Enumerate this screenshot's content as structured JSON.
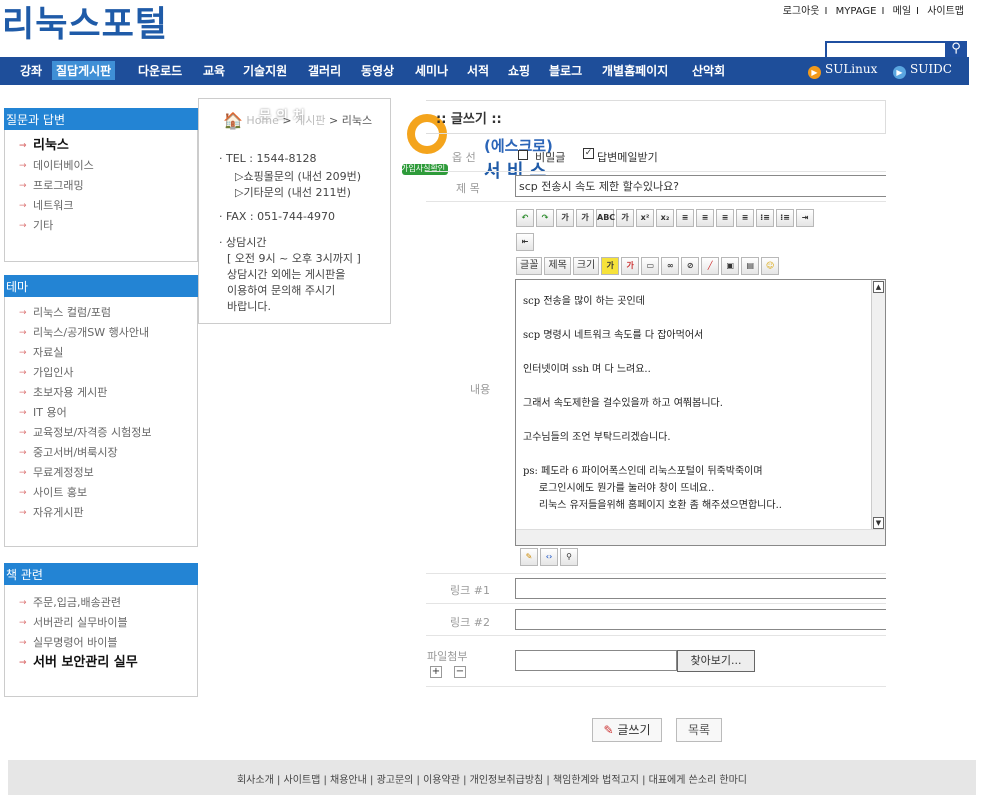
{
  "brand": {
    "logo": "리눅스포털"
  },
  "top_links": [
    "로그아웃",
    "MYPAGE",
    "메일",
    "사이트맵"
  ],
  "nav": {
    "items": [
      "강좌",
      "질답게시판",
      "다운로드",
      "교육",
      "기술지원",
      "갤러리",
      "동영상",
      "세미나",
      "서적",
      "쇼핑",
      "블로그",
      "개별홈페이지",
      "산악회"
    ],
    "active": "질답게시판",
    "ext": [
      "SULinux",
      "SUIDC"
    ]
  },
  "sidebar": {
    "qa": {
      "title": "질문과 답변",
      "items": [
        "리눅스",
        "데이터베이스",
        "프로그래밍",
        "네트워크",
        "기타"
      ]
    },
    "theme": {
      "title": "테마",
      "items": [
        "리눅스 컬럼/포럼",
        "리눅스/공개SW 행사안내",
        "자료실",
        "가입인사",
        "초보자용 게시판",
        "IT 용어",
        "교육정보/자격증 시험정보",
        "중고서버/벼룩시장",
        "무료계정정보",
        "사이트 홍보",
        "자유게시판"
      ]
    },
    "books": {
      "title": "책 관련",
      "items": [
        "주문,입금,배송관련",
        "서버관리 실무바이블",
        "실무명령어 바이블",
        "서버 보안관리 실무"
      ]
    }
  },
  "popup": {
    "title": "문의처",
    "lines": [
      "· TEL : 1544-8128",
      "▷쇼핑몰문의 (내선 209번)",
      "▷기타문의 (내선 211번)",
      "· FAX : 051-744-4970",
      "· 상담시간",
      "[ 오전 9시 ~ 오후 3시까지 ]",
      "상담시간 외에는 게시판을",
      "이용하여 문의해 주시기",
      "바랍니다."
    ]
  },
  "breadcrumb": [
    "Home",
    ">",
    "게시판",
    ">",
    "리눅스"
  ],
  "badge": {
    "line1": "(에스크로)",
    "line2": "서 비 스",
    "tag": "가입사실확인"
  },
  "form": {
    "heading": ":: 글쓰기 ::",
    "options_label": "옵 선",
    "secret_label": "비밀글",
    "email_label": "답변메일받기",
    "subject_label": "제 목",
    "subject_value": "scp 전송시 속도 제한 할수있나요?",
    "content_label": "내용",
    "toolbar_row3": [
      "글꼴",
      "제목",
      "크기"
    ],
    "body_lines": [
      "scp 전송을 많이 하는 곳인데",
      "scp 명령시 네트워크 속도를 다 잡아먹어서",
      "인터넷이며 ssh 며 다 느려요..",
      "그래서 속도제한을 걸수있을까 하고 여쭤봅니다.",
      "고수님들의 조언 부탁드리겠습니다.",
      "ps: 페도라 6 파이어폭스인데 리눅스포털이 뒤죽박죽이며",
      "     로그인시에도 뭔가를 눌러야 창이 뜨네요..",
      "     리눅스 유저들을위해 홈페이지 호환 좀 해주셨으면합니다.."
    ],
    "link1_label": "링크 #1",
    "link2_label": "링크 #2",
    "file_label": "파일첨부",
    "browse_label": "찾아보기...",
    "write_btn": "글쓰기",
    "list_btn": "목록"
  },
  "footer": "회사소개 | 사이트맵 | 채용안내 | 광고문의 | 이용약관 | 개인정보취급방침 | 책임한계와 법적고지 | 대표에게 쓴소리 한마디",
  "colors": {
    "nav": "#1e4e9a",
    "section": "#2384d4",
    "logo": "#1f5ba8"
  }
}
